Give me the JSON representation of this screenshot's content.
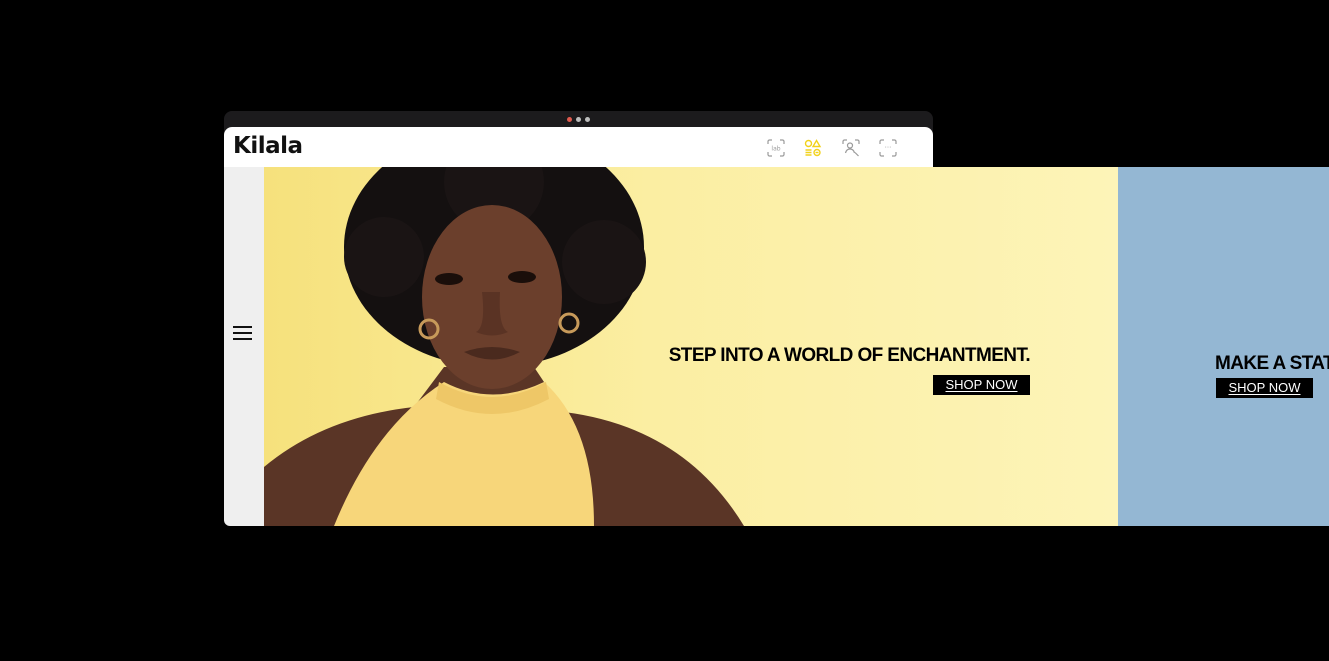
{
  "window": {
    "dots": [
      "#e05a4e",
      "#bdbdbd",
      "#bdbdbd"
    ]
  },
  "header": {
    "logo": "Kilala",
    "tools": [
      {
        "icon": "text-scan-icon",
        "label": "lab"
      },
      {
        "icon": "shapes-filter-icon",
        "active_color": "#f2d21b"
      },
      {
        "icon": "face-scan-icon"
      },
      {
        "icon": "more-frame-icon",
        "label": "···"
      }
    ]
  },
  "rail": {
    "menu_icon": "hamburger-menu-icon"
  },
  "banners": [
    {
      "headline": "STEP INTO A WORLD OF ENCHANTMENT.",
      "cta": "SHOP NOW",
      "background": "#fbeea2"
    },
    {
      "headline": "MAKE A STAT",
      "cta": "SHOP NOW",
      "background": "#94b7d3"
    }
  ]
}
